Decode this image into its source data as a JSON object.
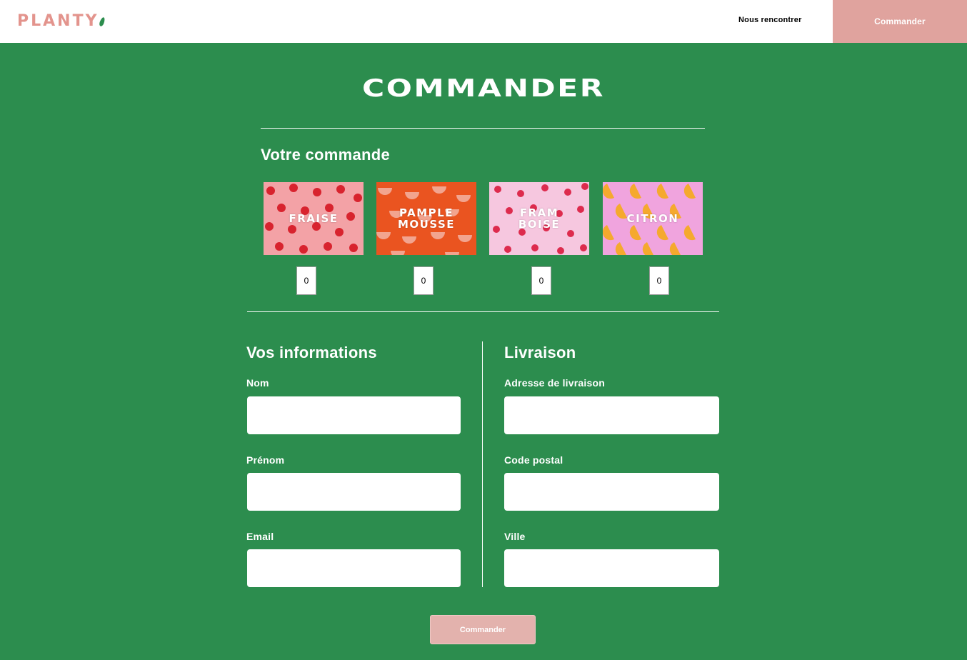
{
  "header": {
    "logo": "PLANTY",
    "nav_link": "Nous rencontrer",
    "nav_cta": "Commander"
  },
  "page": {
    "title": "COMMANDER"
  },
  "order": {
    "heading": "Votre commande",
    "products": [
      {
        "name": "FRAISE",
        "quantity": "0",
        "bg": "#f3a2a6",
        "fruit": "#d8232e"
      },
      {
        "name": "PAMPLE\nMOUSSE",
        "quantity": "0",
        "bg": "#ea5420",
        "fruit": "#f2a48f"
      },
      {
        "name": "FRAM\nBOISE",
        "quantity": "0",
        "bg": "#f6c7df",
        "fruit": "#dd2b4d"
      },
      {
        "name": "CITRON",
        "quantity": "0",
        "bg": "#f0a4de",
        "fruit": "#f5a92e"
      }
    ]
  },
  "info": {
    "heading": "Vos informations",
    "fields": [
      {
        "label": "Nom",
        "value": ""
      },
      {
        "label": "Prénom",
        "value": ""
      },
      {
        "label": "Email",
        "value": ""
      }
    ]
  },
  "delivery": {
    "heading": "Livraison",
    "fields": [
      {
        "label": "Adresse de livraison",
        "value": ""
      },
      {
        "label": "Code postal",
        "value": ""
      },
      {
        "label": "Ville",
        "value": ""
      }
    ]
  },
  "submit": {
    "label": "Commander"
  },
  "colors": {
    "background": "#2c8d4e",
    "accent": "#e0a39e",
    "header": "#ffffff"
  }
}
